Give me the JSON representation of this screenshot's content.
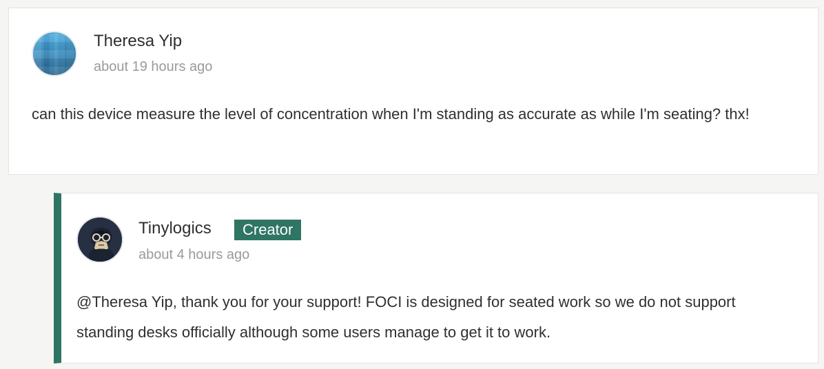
{
  "comment": {
    "author": "Theresa Yip",
    "timestamp": "about 19 hours ago",
    "text": "can this device measure the level of concentration when I'm standing as accurate as while I'm seating? thx!"
  },
  "reply": {
    "author": "Tinylogics",
    "badge": "Creator",
    "timestamp": "about 4 hours ago",
    "text": "@Theresa Yip, thank you for your support! FOCI is designed for seated work so we do not support standing desks officially although some users manage to get it to work."
  },
  "colors": {
    "accent": "#2f7564",
    "text": "#2f2f2f",
    "muted": "#9a9a9a"
  },
  "icons": {
    "comment_avatar": "mosaic-avatar-icon",
    "reply_avatar": "gorilla-avatar-icon"
  }
}
